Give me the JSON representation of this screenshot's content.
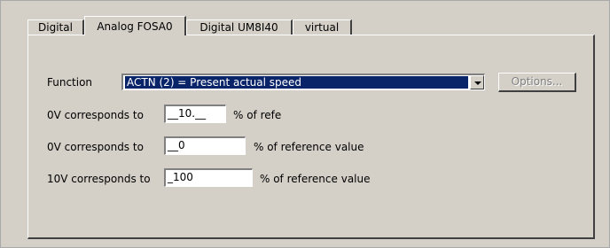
{
  "tabs": [
    {
      "label": "Digital",
      "active": false
    },
    {
      "label": "Analog FOSA0",
      "active": true
    },
    {
      "label": "Digital UM8I40",
      "active": false
    },
    {
      "label": "virtual",
      "active": false
    }
  ],
  "function": {
    "label": "Function",
    "selected_value": "ACTN (2) = Present actual speed",
    "options_button": "Options...",
    "options_enabled": false
  },
  "rows": [
    {
      "label": "0V corresponds to",
      "value": "__10.__",
      "suffix": "% of refe"
    },
    {
      "label": "0V corresponds to",
      "value": "__0",
      "suffix": "% of reference value"
    },
    {
      "label": "10V corresponds to",
      "value": "_100",
      "suffix": "% of reference value"
    }
  ],
  "colors": {
    "face": "#d4d0c8",
    "selection": "#0a246a",
    "disabled_text": "#808080"
  },
  "icons": {
    "dropdown": "chevron-down-icon"
  }
}
